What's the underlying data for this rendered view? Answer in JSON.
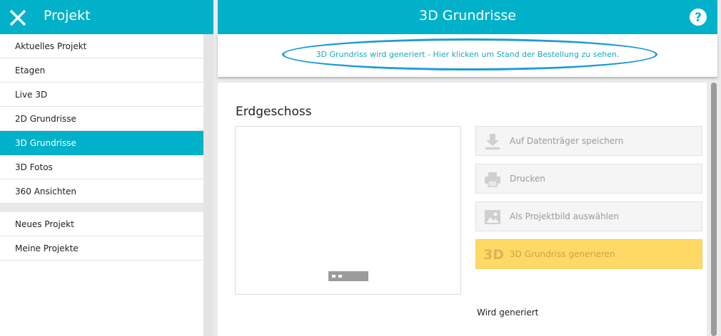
{
  "sidebar": {
    "title": "Projekt",
    "items": [
      {
        "label": "Aktuelles Projekt",
        "active": false
      },
      {
        "label": "Etagen",
        "active": false
      },
      {
        "label": "Live 3D",
        "active": false
      },
      {
        "label": "2D Grundrisse",
        "active": false
      },
      {
        "label": "3D Grundrisse",
        "active": true
      },
      {
        "label": "3D Fotos",
        "active": false
      },
      {
        "label": "360 Ansichten",
        "active": false
      }
    ],
    "items2": [
      {
        "label": "Neues Projekt"
      },
      {
        "label": "Meine Projekte"
      }
    ]
  },
  "header": {
    "title": "3D Grundrisse"
  },
  "status": {
    "link_text": "3D Grundriss wird generiert - Hier klicken um Stand der Bestellung zu sehen."
  },
  "main": {
    "section_title": "Erdgeschoss",
    "actions": {
      "save": "Auf Datenträger speichern",
      "print": "Drucken",
      "project_image": "Als Projektbild auswählen",
      "generate": "3D Grundriss generieren",
      "generate_icon": "3D"
    },
    "status_text": "Wird generiert"
  },
  "colors": {
    "accent": "#00b1c9",
    "highlight_ellipse": "#1d9bd8",
    "generate_button": "#ffd966"
  },
  "icons": [
    "close-icon",
    "help-icon",
    "download-icon",
    "printer-icon",
    "image-icon",
    "3d-icon"
  ]
}
